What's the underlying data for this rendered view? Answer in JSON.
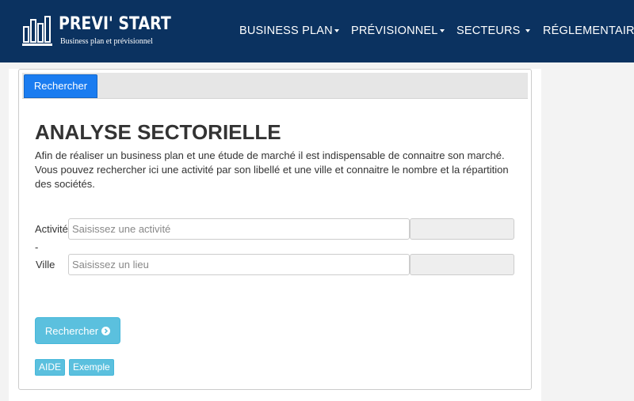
{
  "brand": {
    "title": "PREVI' START",
    "subtitle": "Business plan et prévisionnel"
  },
  "nav": {
    "items": [
      {
        "label": "BUSINESS PLAN"
      },
      {
        "label": "PRÉVISIONNEL"
      },
      {
        "label": "SECTEURS"
      },
      {
        "label": "RÉGLEMENTAIRE"
      }
    ]
  },
  "tabs": {
    "active_label": "Rechercher"
  },
  "main": {
    "heading": "ANALYSE SECTORIELLE",
    "intro": "Afin de réaliser un business plan et une étude de marché il est indispensable de connaitre son marché. Vous pouvez rechercher ici une activité par son libellé et une ville et connaitre le nombre et la répartition des sociétés."
  },
  "form": {
    "activity_label": "Activité",
    "separator": "-",
    "activity_placeholder": "Saisissez une activité",
    "city_label": "Ville",
    "city_placeholder": "Saisissez un lieu",
    "search_button": "Rechercher",
    "help_button": "AIDE",
    "example_button": "Exemple"
  },
  "colors": {
    "navbar": "#0b3260",
    "primary": "#1a7cf0",
    "info": "#5bc0de"
  }
}
